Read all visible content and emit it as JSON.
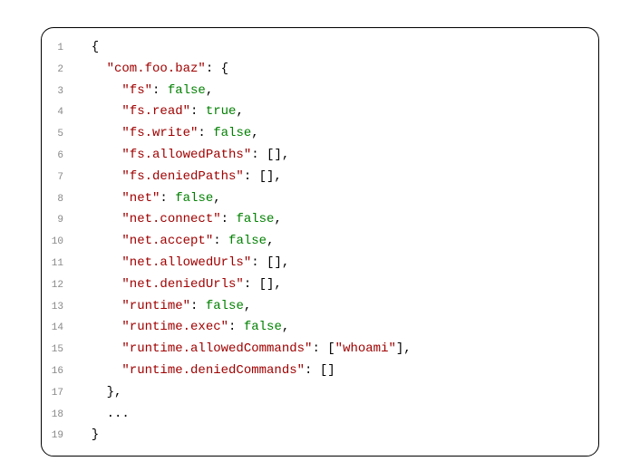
{
  "lines": [
    {
      "n": "1",
      "indent": 1,
      "tokens": [
        {
          "t": "punc",
          "v": "{"
        }
      ]
    },
    {
      "n": "2",
      "indent": 2,
      "tokens": [
        {
          "t": "key",
          "v": "\"com.foo.baz\""
        },
        {
          "t": "punc",
          "v": ": {"
        }
      ]
    },
    {
      "n": "3",
      "indent": 3,
      "tokens": [
        {
          "t": "key",
          "v": "\"fs\""
        },
        {
          "t": "punc",
          "v": ": "
        },
        {
          "t": "bool",
          "v": "false"
        },
        {
          "t": "punc",
          "v": ","
        }
      ]
    },
    {
      "n": "4",
      "indent": 3,
      "tokens": [
        {
          "t": "key",
          "v": "\"fs.read\""
        },
        {
          "t": "punc",
          "v": ": "
        },
        {
          "t": "bool",
          "v": "true"
        },
        {
          "t": "punc",
          "v": ","
        }
      ]
    },
    {
      "n": "5",
      "indent": 3,
      "tokens": [
        {
          "t": "key",
          "v": "\"fs.write\""
        },
        {
          "t": "punc",
          "v": ": "
        },
        {
          "t": "bool",
          "v": "false"
        },
        {
          "t": "punc",
          "v": ","
        }
      ]
    },
    {
      "n": "6",
      "indent": 3,
      "tokens": [
        {
          "t": "key",
          "v": "\"fs.allowedPaths\""
        },
        {
          "t": "punc",
          "v": ": [],"
        }
      ]
    },
    {
      "n": "7",
      "indent": 3,
      "tokens": [
        {
          "t": "key",
          "v": "\"fs.deniedPaths\""
        },
        {
          "t": "punc",
          "v": ": [],"
        }
      ]
    },
    {
      "n": "8",
      "indent": 3,
      "tokens": [
        {
          "t": "key",
          "v": "\"net\""
        },
        {
          "t": "punc",
          "v": ": "
        },
        {
          "t": "bool",
          "v": "false"
        },
        {
          "t": "punc",
          "v": ","
        }
      ]
    },
    {
      "n": "9",
      "indent": 3,
      "tokens": [
        {
          "t": "key",
          "v": "\"net.connect\""
        },
        {
          "t": "punc",
          "v": ": "
        },
        {
          "t": "bool",
          "v": "false"
        },
        {
          "t": "punc",
          "v": ","
        }
      ]
    },
    {
      "n": "10",
      "indent": 3,
      "tokens": [
        {
          "t": "key",
          "v": "\"net.accept\""
        },
        {
          "t": "punc",
          "v": ": "
        },
        {
          "t": "bool",
          "v": "false"
        },
        {
          "t": "punc",
          "v": ","
        }
      ]
    },
    {
      "n": "11",
      "indent": 3,
      "tokens": [
        {
          "t": "key",
          "v": "\"net.allowedUrls\""
        },
        {
          "t": "punc",
          "v": ": [],"
        }
      ]
    },
    {
      "n": "12",
      "indent": 3,
      "tokens": [
        {
          "t": "key",
          "v": "\"net.deniedUrls\""
        },
        {
          "t": "punc",
          "v": ": [],"
        }
      ]
    },
    {
      "n": "13",
      "indent": 3,
      "tokens": [
        {
          "t": "key",
          "v": "\"runtime\""
        },
        {
          "t": "punc",
          "v": ": "
        },
        {
          "t": "bool",
          "v": "false"
        },
        {
          "t": "punc",
          "v": ","
        }
      ]
    },
    {
      "n": "14",
      "indent": 3,
      "tokens": [
        {
          "t": "key",
          "v": "\"runtime.exec\""
        },
        {
          "t": "punc",
          "v": ": "
        },
        {
          "t": "bool",
          "v": "false"
        },
        {
          "t": "punc",
          "v": ","
        }
      ]
    },
    {
      "n": "15",
      "indent": 3,
      "tokens": [
        {
          "t": "key",
          "v": "\"runtime.allowedCommands\""
        },
        {
          "t": "punc",
          "v": ": ["
        },
        {
          "t": "str",
          "v": "\"whoami\""
        },
        {
          "t": "punc",
          "v": "],"
        }
      ]
    },
    {
      "n": "16",
      "indent": 3,
      "tokens": [
        {
          "t": "key",
          "v": "\"runtime.deniedCommands\""
        },
        {
          "t": "punc",
          "v": ": []"
        }
      ]
    },
    {
      "n": "17",
      "indent": 2,
      "tokens": [
        {
          "t": "punc",
          "v": "},"
        }
      ]
    },
    {
      "n": "18",
      "indent": 2,
      "tokens": [
        {
          "t": "ellipsis",
          "v": "..."
        }
      ]
    },
    {
      "n": "19",
      "indent": 1,
      "tokens": [
        {
          "t": "punc",
          "v": "}"
        }
      ]
    }
  ]
}
